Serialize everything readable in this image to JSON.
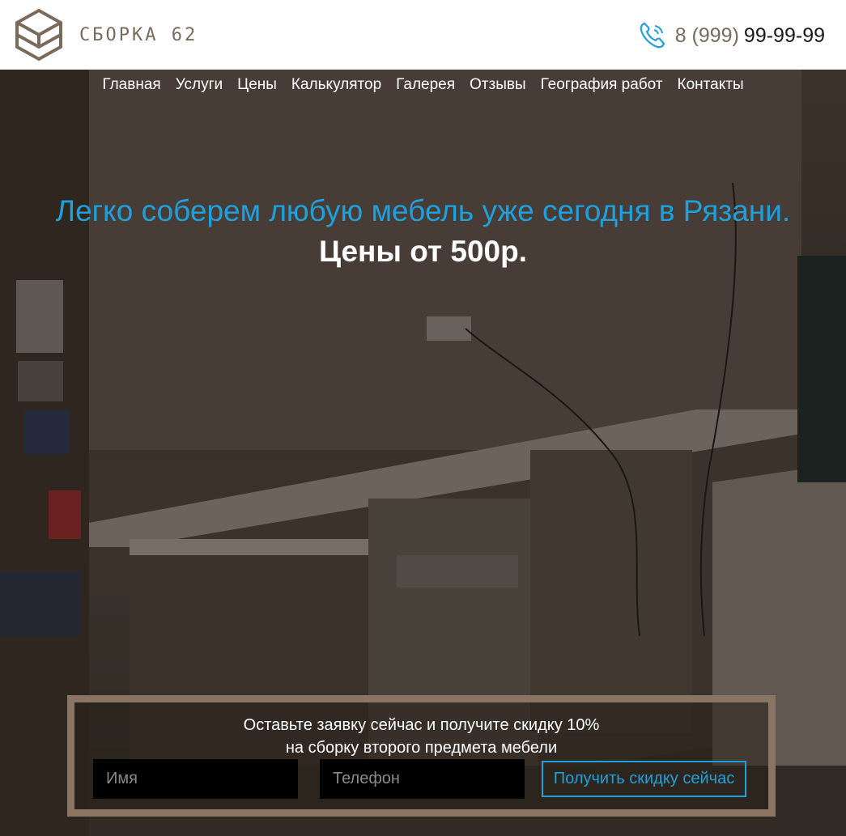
{
  "brand": {
    "name": "СБОРКА 62"
  },
  "phone": {
    "code": "8 (999)",
    "number": "99-99-99"
  },
  "nav": {
    "items": [
      "Главная",
      "Услуги",
      "Цены",
      "Калькулятор",
      "Галерея",
      "Отзывы",
      "География работ",
      "Контакты"
    ]
  },
  "hero": {
    "headline": "Легко соберем любую мебель уже сегодня в Рязани.",
    "subline": "Цены от 500р."
  },
  "form": {
    "line1": "Оставьте заявку сейчас и получите скидку 10%",
    "line2": "на сборку второго предмета мебели",
    "name_placeholder": "Имя",
    "phone_placeholder": "Телефон",
    "submit_label": "Получить скидку сейчас"
  },
  "colors": {
    "accent": "#1ea0dc",
    "brand": "#7a6a5a",
    "frame": "#8a7462"
  }
}
